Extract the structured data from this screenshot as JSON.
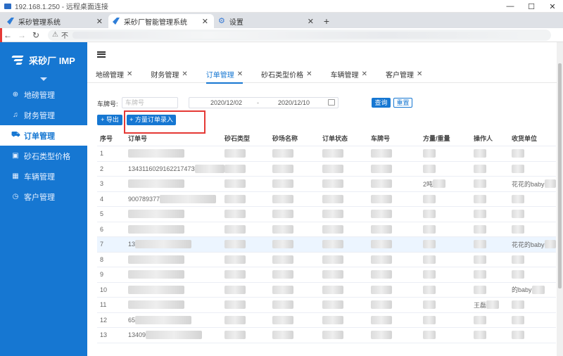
{
  "rdp": {
    "title": "192.168.1.250 - 远程桌面连接"
  },
  "browser": {
    "tabs": [
      {
        "label": "采砂管理系统",
        "active": false
      },
      {
        "label": "采砂厂智能管理系统",
        "active": true
      },
      {
        "label": "设置",
        "active": false
      }
    ],
    "address_prefix": "不"
  },
  "app": {
    "logo": "采砂厂 IMP",
    "menu": [
      {
        "label": "地磅管理",
        "icon": "globe-icon",
        "active": false
      },
      {
        "label": "财务管理",
        "icon": "bell-icon",
        "active": false
      },
      {
        "label": "订单管理",
        "icon": "cart-icon",
        "active": true
      },
      {
        "label": "砂石类型价格",
        "icon": "image-icon",
        "active": false
      },
      {
        "label": "车辆管理",
        "icon": "grid-icon",
        "active": false
      },
      {
        "label": "客户管理",
        "icon": "clock-icon",
        "active": false
      }
    ],
    "page_tabs": [
      {
        "label": "地磅管理",
        "active": false
      },
      {
        "label": "财务管理",
        "active": false
      },
      {
        "label": "订单管理",
        "active": true
      },
      {
        "label": "砂石类型价格",
        "active": false
      },
      {
        "label": "车辆管理",
        "active": false
      },
      {
        "label": "客户管理",
        "active": false
      }
    ],
    "filters": {
      "plate_label": "车牌号:",
      "plate_placeholder": "车牌号",
      "date_start": "2020/12/02",
      "date_sep": "-",
      "date_end": "2020/12/10",
      "query_btn": "查询",
      "reset_btn": "重置"
    },
    "actions": {
      "export": "+ 导出",
      "square_order": "+ 方量订单录入"
    },
    "table": {
      "headers": [
        "序号",
        "订单号",
        "砂石类型",
        "砂场名称",
        "订单状态",
        "车牌号",
        "方量/重量",
        "操作人",
        "收货单位"
      ],
      "rows": [
        {
          "no": "1",
          "order": "",
          "qty": "",
          "op": "",
          "recv": ""
        },
        {
          "no": "2",
          "order": "134311602916221747З",
          "qty": "",
          "op": "",
          "recv": ""
        },
        {
          "no": "3",
          "order": "",
          "qty": "2吨",
          "op": "",
          "recv": "花花的baby"
        },
        {
          "no": "4",
          "order": "900789377",
          "qty": "",
          "op": "",
          "recv": ""
        },
        {
          "no": "5",
          "order": "",
          "qty": "",
          "op": "",
          "recv": ""
        },
        {
          "no": "6",
          "order": "",
          "qty": "",
          "op": "",
          "recv": ""
        },
        {
          "no": "7",
          "order": "13",
          "qty": "",
          "op": "",
          "recv": "花花的baby"
        },
        {
          "no": "8",
          "order": "",
          "qty": "",
          "op": "",
          "recv": ""
        },
        {
          "no": "9",
          "order": "",
          "qty": "",
          "op": "",
          "recv": ""
        },
        {
          "no": "10",
          "order": "",
          "qty": "",
          "op": "",
          "recv": "的baby"
        },
        {
          "no": "11",
          "order": "",
          "qty": "",
          "op": "王磊",
          "recv": ""
        },
        {
          "no": "12",
          "order": "65",
          "qty": "",
          "op": "",
          "recv": ""
        },
        {
          "no": "13",
          "order": "13409",
          "qty": "",
          "op": "",
          "recv": ""
        }
      ]
    }
  },
  "colors": {
    "brand": "#1677d2",
    "highlight": "#e53935",
    "row_hover": "#ecf5ff"
  }
}
